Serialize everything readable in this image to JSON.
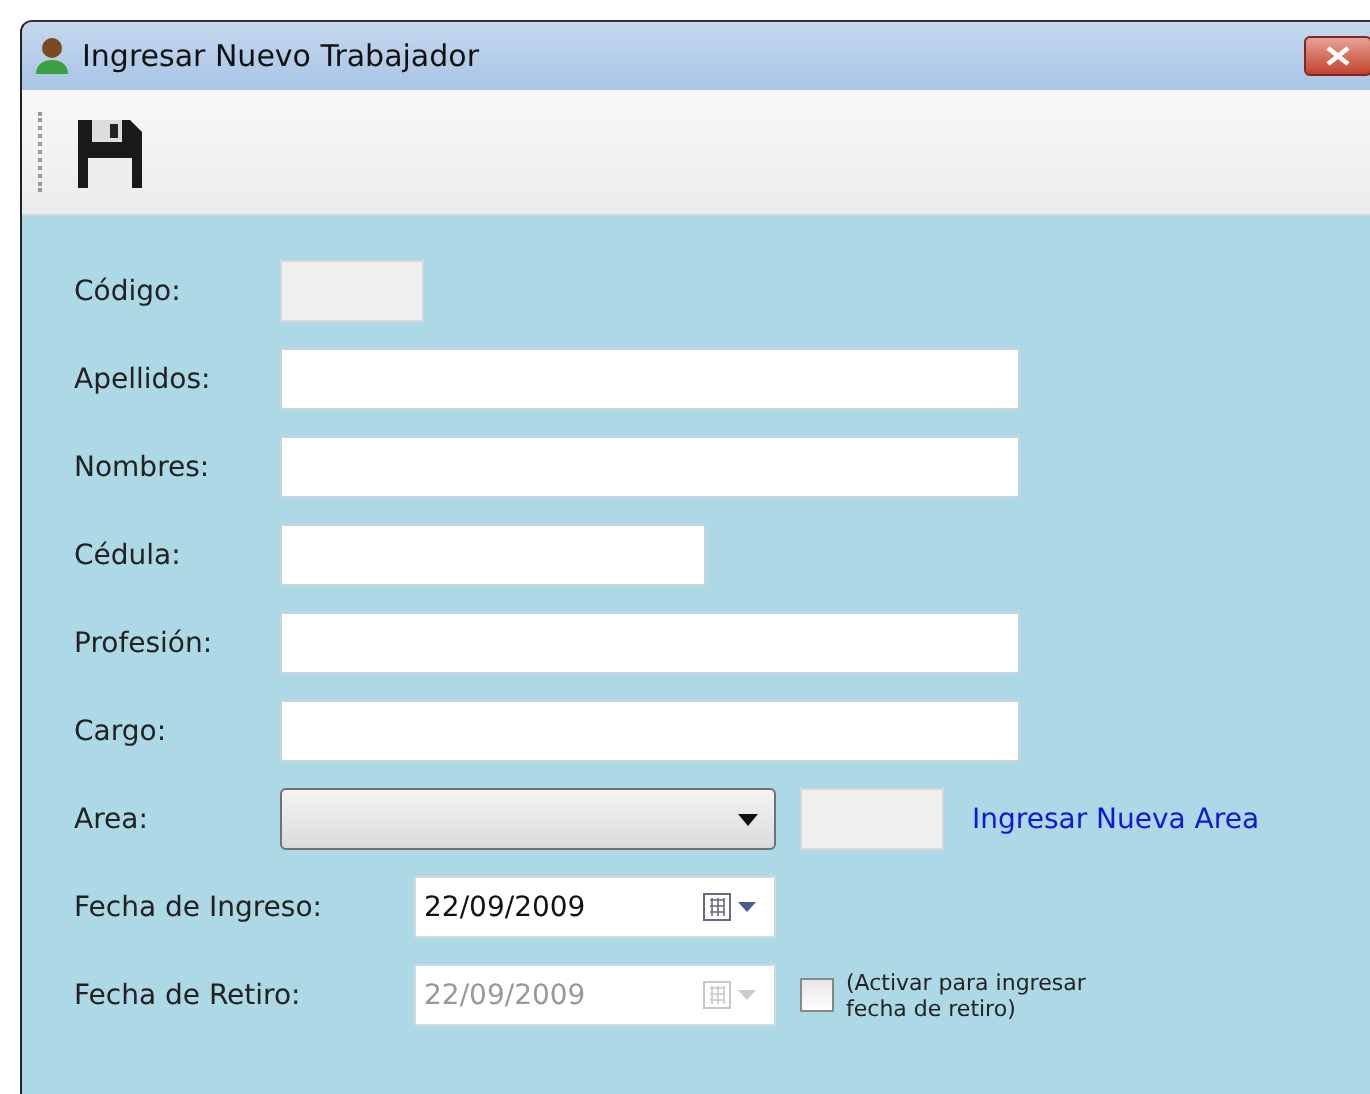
{
  "window": {
    "title": "Ingresar Nuevo Trabajador"
  },
  "fields": [
    {
      "kind": "text",
      "label": "Código:",
      "disabled": true
    },
    {
      "kind": "text",
      "label": "Apellidos:",
      "disabled": false
    },
    {
      "kind": "text",
      "label": "Nombres:",
      "disabled": false
    },
    {
      "kind": "text",
      "label": "Cédula:",
      "disabled": false
    },
    {
      "kind": "text",
      "label": "Profesión:",
      "disabled": false
    },
    {
      "kind": "text",
      "label": "Cargo:",
      "disabled": false
    },
    {
      "kind": "combo",
      "label": "Area:",
      "link": "Ingresar Nueva Area"
    },
    {
      "kind": "date",
      "label": "Fecha de Ingreso:",
      "value": "22/09/2009",
      "disabled": false
    },
    {
      "kind": "date",
      "label": "Fecha de Retiro:",
      "value": "22/09/2009",
      "disabled": true,
      "checkbox": {
        "checked": false,
        "label": "(Activar para ingresar\nfecha de retiro)"
      }
    }
  ]
}
